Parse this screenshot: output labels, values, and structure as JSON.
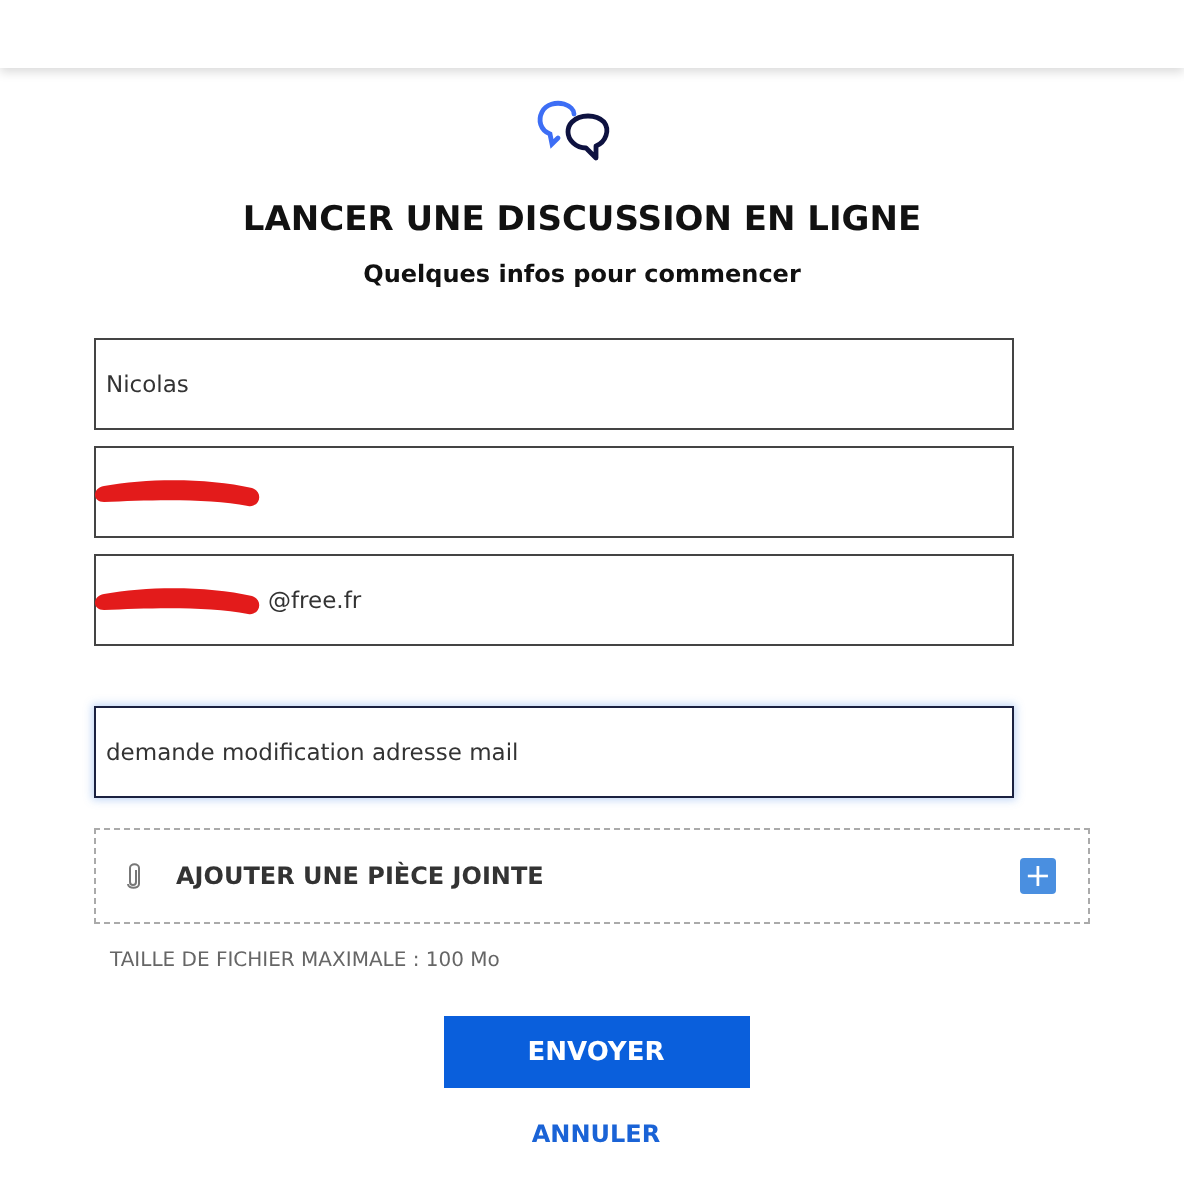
{
  "title": "LANCER UNE DISCUSSION EN LIGNE",
  "subtitle": "Quelques infos pour commencer",
  "fields": [
    {
      "value": "Nicolas",
      "redacted": false,
      "focused": false
    },
    {
      "redacted": true,
      "focused": false
    },
    {
      "value": "@free.fr",
      "redacted": true,
      "focused": false
    },
    {
      "value": "demande modification adresse mail",
      "redacted": false,
      "focused": true
    }
  ],
  "attachment": {
    "label": "AJOUTER UNE PIÈCE JOINTE",
    "plus": "+"
  },
  "size_note": "TAILLE DE FICHIER MAXIMALE : 100 Mo",
  "buttons": {
    "send": "ENVOYER",
    "cancel": "ANNULER"
  }
}
